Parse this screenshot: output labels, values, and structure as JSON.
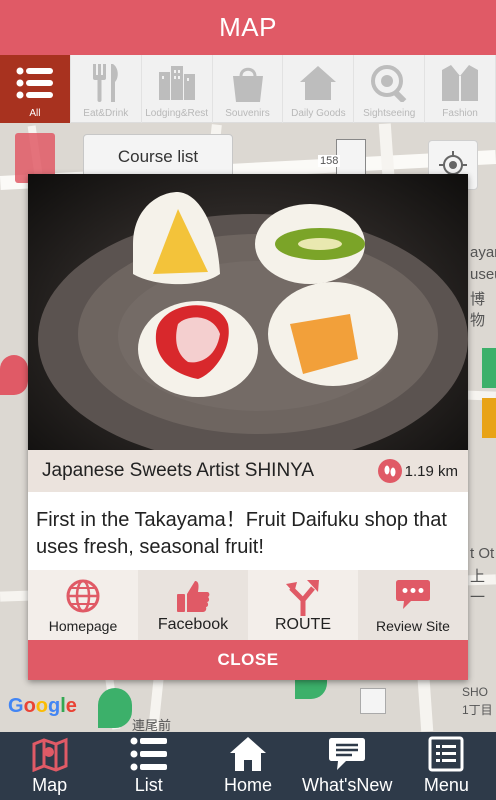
{
  "header": {
    "title": "MAP"
  },
  "categories": [
    {
      "label": "All",
      "icon": "list-icon",
      "active": true
    },
    {
      "label": "Eat&Drink",
      "icon": "fork-knife-icon"
    },
    {
      "label": "Lodging&Rest",
      "icon": "building-icon"
    },
    {
      "label": "Souvenirs",
      "icon": "shopping-bag-icon"
    },
    {
      "label": "Daily Goods",
      "icon": "house-icon"
    },
    {
      "label": "Sightseeing",
      "icon": "eye-icon"
    },
    {
      "label": "Fashion",
      "icon": "jacket-icon"
    }
  ],
  "map": {
    "course_list_label": "Course list",
    "road_number": "158",
    "google_logo": "Google",
    "text_fragments": [
      "ayar",
      "useu",
      "博物",
      "t Ot",
      "上一",
      "SHO",
      "1丁目",
      "連尾前"
    ]
  },
  "popup": {
    "shop_name": "Japanese Sweets Artist SHINYA",
    "distance": "1.19 km",
    "description": "First in the Takayama！Fruit Daifuku shop that uses fresh, seasonal fruit!",
    "actions": [
      {
        "label": "Homepage",
        "icon": "globe-icon"
      },
      {
        "label": "Facebook",
        "icon": "thumbs-up-icon"
      },
      {
        "label": "ROUTE",
        "icon": "route-arrows-icon"
      },
      {
        "label": "Review Site",
        "icon": "chat-bubble-icon"
      }
    ],
    "close_label": "CLOSE"
  },
  "bottom_nav": [
    {
      "label": "Map",
      "icon": "map-icon",
      "active": true
    },
    {
      "label": "List",
      "icon": "list-icon"
    },
    {
      "label": "Home",
      "icon": "home-icon"
    },
    {
      "label": "What'sNew",
      "icon": "chat-icon"
    },
    {
      "label": "Menu",
      "icon": "menu-icon"
    }
  ],
  "colors": {
    "accent": "#e05a66",
    "category_active": "#a8321f",
    "nav_bg": "#2e3a49"
  }
}
